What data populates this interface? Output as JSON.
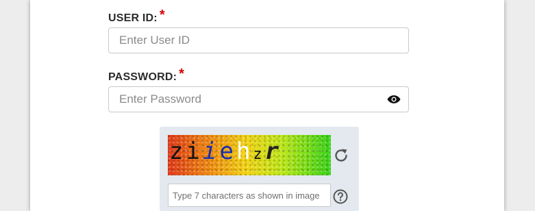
{
  "login_form": {
    "user_id": {
      "label": "USER ID:",
      "required_marker": "*",
      "placeholder": "Enter User ID",
      "value": ""
    },
    "password": {
      "label": "PASSWORD:",
      "required_marker": "*",
      "placeholder": "Enter Password",
      "value": "",
      "toggle_icon": "eye-icon"
    },
    "captcha": {
      "characters": [
        "z",
        "i",
        "i",
        "e",
        "h",
        "z",
        "r"
      ],
      "refresh_icon": "refresh-icon",
      "input_placeholder": "Type 7 characters as shown in image",
      "input_value": "",
      "help_icon": "question-circle-icon"
    }
  },
  "colors": {
    "required": "#d40000",
    "captcha_panel_bg": "#e3e9ee",
    "captcha_italic_chars": "#1a2db0"
  }
}
